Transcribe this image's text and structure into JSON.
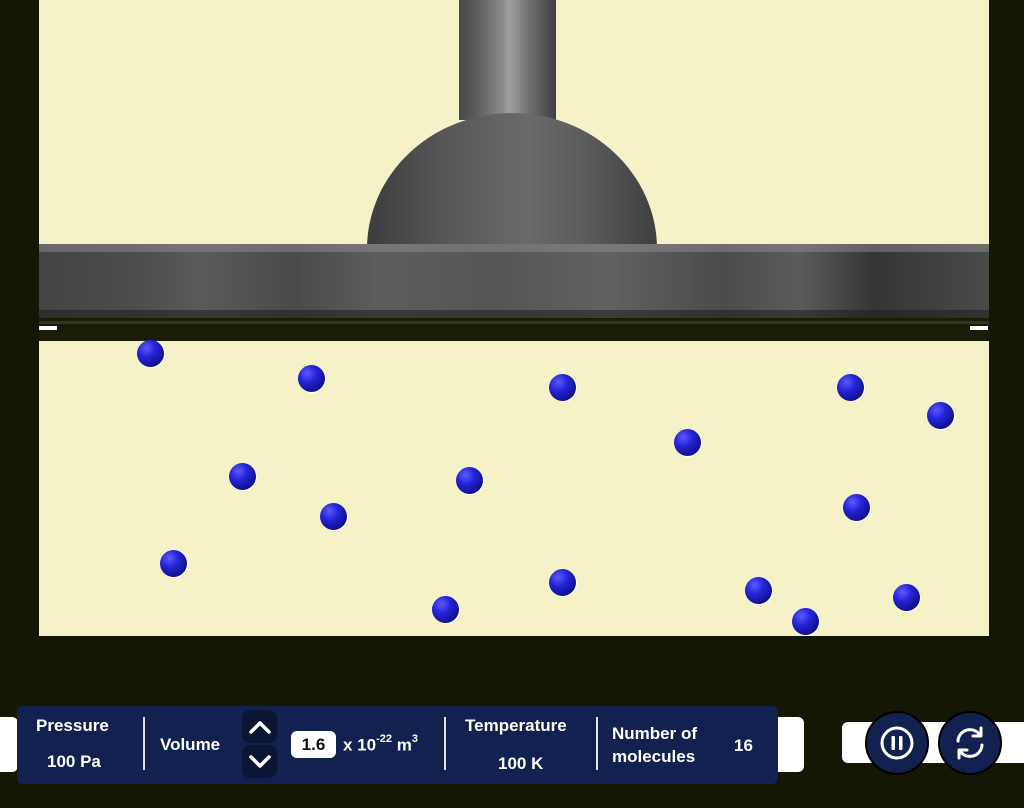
{
  "readouts": {
    "pressure": {
      "label": "Pressure",
      "value": "100 Pa"
    },
    "volume": {
      "label": "Volume",
      "value": "1.6",
      "unit_prefix": "x 10",
      "unit_exponent": "-22",
      "unit": " m",
      "unit_power": "3"
    },
    "temperature": {
      "label": "Temperature",
      "value": "100 K"
    },
    "molecules": {
      "label_line1": "Number of",
      "label_line2": "molecules",
      "value": "16"
    }
  },
  "controls": {
    "volume_up_icon": "chevron-up-icon",
    "volume_down_icon": "chevron-down-icon",
    "pause_icon": "pause-icon",
    "reset_icon": "reset-icon"
  },
  "colors": {
    "background": "#141703",
    "chamber": "#f4f2c6",
    "panel": "#12214f",
    "molecule": "#2424d8"
  }
}
